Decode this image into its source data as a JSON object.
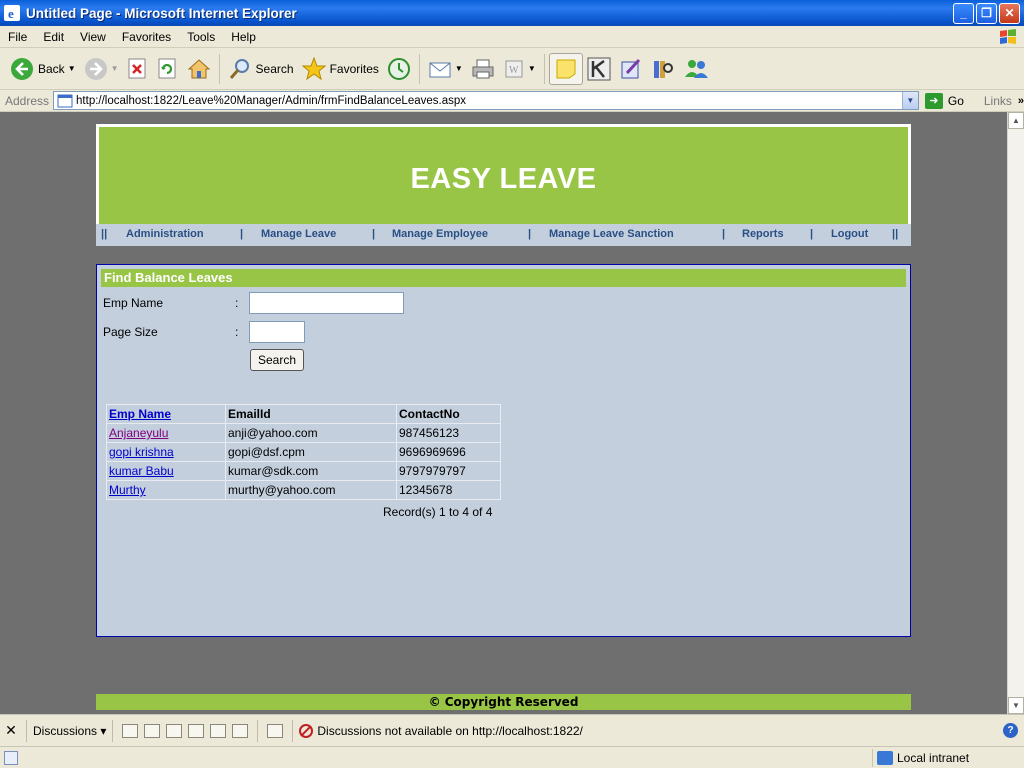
{
  "window": {
    "title": "Untitled Page - Microsoft Internet Explorer",
    "controls": {
      "minimize": "_",
      "maximize": "❐",
      "close": "✕"
    }
  },
  "menu": [
    "File",
    "Edit",
    "View",
    "Favorites",
    "Tools",
    "Help"
  ],
  "toolbar": {
    "back_label": "Back",
    "search_label": "Search",
    "favorites_label": "Favorites"
  },
  "address": {
    "label": "Address",
    "url": "http://localhost:1822/Leave%20Manager/Admin/frmFindBalanceLeaves.aspx",
    "go_label": "Go",
    "links_label": "Links",
    "links_chevron": "»"
  },
  "site": {
    "brand": "EASY LEAVE",
    "nav": {
      "sep_left": "||",
      "items": [
        "Administration",
        "Manage Leave",
        "Manage Employee",
        "Manage Leave Sanction",
        "Reports",
        "Logout"
      ],
      "separator": "|",
      "sep_right": "||"
    },
    "footer": "© Copyright Reserved"
  },
  "panel": {
    "title": "Find Balance Leaves",
    "emp_name_label": "Emp Name",
    "page_size_label": "Page Size",
    "colon": ":",
    "emp_name_value": "",
    "page_size_value": "",
    "search_button": "Search"
  },
  "grid": {
    "headers": [
      "Emp Name",
      "EmailId",
      "ContactNo"
    ],
    "rows": [
      {
        "name": "Anjaneyulu",
        "email": "anji@yahoo.com",
        "contact": "987456123"
      },
      {
        "name": "gopi krishna",
        "email": "gopi@dsf.cpm",
        "contact": "9696969696"
      },
      {
        "name": "kumar Babu",
        "email": "kumar@sdk.com",
        "contact": "9797979797"
      },
      {
        "name": "Murthy",
        "email": "murthy@yahoo.com",
        "contact": "12345678"
      }
    ],
    "records_text": "Record(s) 1 to 4 of 4"
  },
  "discussions": {
    "close": "✕",
    "label": "Discussions ▾",
    "message": "Discussions not available on http://localhost:1822/"
  },
  "status": {
    "zone": "Local intranet"
  },
  "colors": {
    "accent_green": "#99c547",
    "panel_bg": "#c3cfdd",
    "nav_text": "#2a4f85",
    "viewport_bg": "#6f6f6f"
  }
}
